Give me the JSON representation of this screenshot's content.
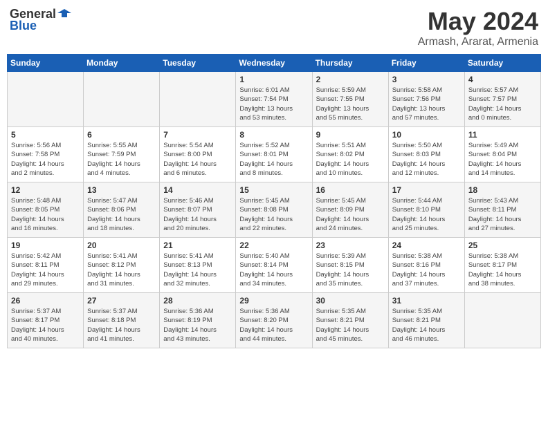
{
  "header": {
    "logo_general": "General",
    "logo_blue": "Blue",
    "title": "May 2024",
    "location": "Armash, Ararat, Armenia"
  },
  "days_of_week": [
    "Sunday",
    "Monday",
    "Tuesday",
    "Wednesday",
    "Thursday",
    "Friday",
    "Saturday"
  ],
  "weeks": [
    [
      {
        "day": "",
        "info": ""
      },
      {
        "day": "",
        "info": ""
      },
      {
        "day": "",
        "info": ""
      },
      {
        "day": "1",
        "info": "Sunrise: 6:01 AM\nSunset: 7:54 PM\nDaylight: 13 hours\nand 53 minutes."
      },
      {
        "day": "2",
        "info": "Sunrise: 5:59 AM\nSunset: 7:55 PM\nDaylight: 13 hours\nand 55 minutes."
      },
      {
        "day": "3",
        "info": "Sunrise: 5:58 AM\nSunset: 7:56 PM\nDaylight: 13 hours\nand 57 minutes."
      },
      {
        "day": "4",
        "info": "Sunrise: 5:57 AM\nSunset: 7:57 PM\nDaylight: 14 hours\nand 0 minutes."
      }
    ],
    [
      {
        "day": "5",
        "info": "Sunrise: 5:56 AM\nSunset: 7:58 PM\nDaylight: 14 hours\nand 2 minutes."
      },
      {
        "day": "6",
        "info": "Sunrise: 5:55 AM\nSunset: 7:59 PM\nDaylight: 14 hours\nand 4 minutes."
      },
      {
        "day": "7",
        "info": "Sunrise: 5:54 AM\nSunset: 8:00 PM\nDaylight: 14 hours\nand 6 minutes."
      },
      {
        "day": "8",
        "info": "Sunrise: 5:52 AM\nSunset: 8:01 PM\nDaylight: 14 hours\nand 8 minutes."
      },
      {
        "day": "9",
        "info": "Sunrise: 5:51 AM\nSunset: 8:02 PM\nDaylight: 14 hours\nand 10 minutes."
      },
      {
        "day": "10",
        "info": "Sunrise: 5:50 AM\nSunset: 8:03 PM\nDaylight: 14 hours\nand 12 minutes."
      },
      {
        "day": "11",
        "info": "Sunrise: 5:49 AM\nSunset: 8:04 PM\nDaylight: 14 hours\nand 14 minutes."
      }
    ],
    [
      {
        "day": "12",
        "info": "Sunrise: 5:48 AM\nSunset: 8:05 PM\nDaylight: 14 hours\nand 16 minutes."
      },
      {
        "day": "13",
        "info": "Sunrise: 5:47 AM\nSunset: 8:06 PM\nDaylight: 14 hours\nand 18 minutes."
      },
      {
        "day": "14",
        "info": "Sunrise: 5:46 AM\nSunset: 8:07 PM\nDaylight: 14 hours\nand 20 minutes."
      },
      {
        "day": "15",
        "info": "Sunrise: 5:45 AM\nSunset: 8:08 PM\nDaylight: 14 hours\nand 22 minutes."
      },
      {
        "day": "16",
        "info": "Sunrise: 5:45 AM\nSunset: 8:09 PM\nDaylight: 14 hours\nand 24 minutes."
      },
      {
        "day": "17",
        "info": "Sunrise: 5:44 AM\nSunset: 8:10 PM\nDaylight: 14 hours\nand 25 minutes."
      },
      {
        "day": "18",
        "info": "Sunrise: 5:43 AM\nSunset: 8:11 PM\nDaylight: 14 hours\nand 27 minutes."
      }
    ],
    [
      {
        "day": "19",
        "info": "Sunrise: 5:42 AM\nSunset: 8:11 PM\nDaylight: 14 hours\nand 29 minutes."
      },
      {
        "day": "20",
        "info": "Sunrise: 5:41 AM\nSunset: 8:12 PM\nDaylight: 14 hours\nand 31 minutes."
      },
      {
        "day": "21",
        "info": "Sunrise: 5:41 AM\nSunset: 8:13 PM\nDaylight: 14 hours\nand 32 minutes."
      },
      {
        "day": "22",
        "info": "Sunrise: 5:40 AM\nSunset: 8:14 PM\nDaylight: 14 hours\nand 34 minutes."
      },
      {
        "day": "23",
        "info": "Sunrise: 5:39 AM\nSunset: 8:15 PM\nDaylight: 14 hours\nand 35 minutes."
      },
      {
        "day": "24",
        "info": "Sunrise: 5:38 AM\nSunset: 8:16 PM\nDaylight: 14 hours\nand 37 minutes."
      },
      {
        "day": "25",
        "info": "Sunrise: 5:38 AM\nSunset: 8:17 PM\nDaylight: 14 hours\nand 38 minutes."
      }
    ],
    [
      {
        "day": "26",
        "info": "Sunrise: 5:37 AM\nSunset: 8:17 PM\nDaylight: 14 hours\nand 40 minutes."
      },
      {
        "day": "27",
        "info": "Sunrise: 5:37 AM\nSunset: 8:18 PM\nDaylight: 14 hours\nand 41 minutes."
      },
      {
        "day": "28",
        "info": "Sunrise: 5:36 AM\nSunset: 8:19 PM\nDaylight: 14 hours\nand 43 minutes."
      },
      {
        "day": "29",
        "info": "Sunrise: 5:36 AM\nSunset: 8:20 PM\nDaylight: 14 hours\nand 44 minutes."
      },
      {
        "day": "30",
        "info": "Sunrise: 5:35 AM\nSunset: 8:21 PM\nDaylight: 14 hours\nand 45 minutes."
      },
      {
        "day": "31",
        "info": "Sunrise: 5:35 AM\nSunset: 8:21 PM\nDaylight: 14 hours\nand 46 minutes."
      },
      {
        "day": "",
        "info": ""
      }
    ]
  ]
}
